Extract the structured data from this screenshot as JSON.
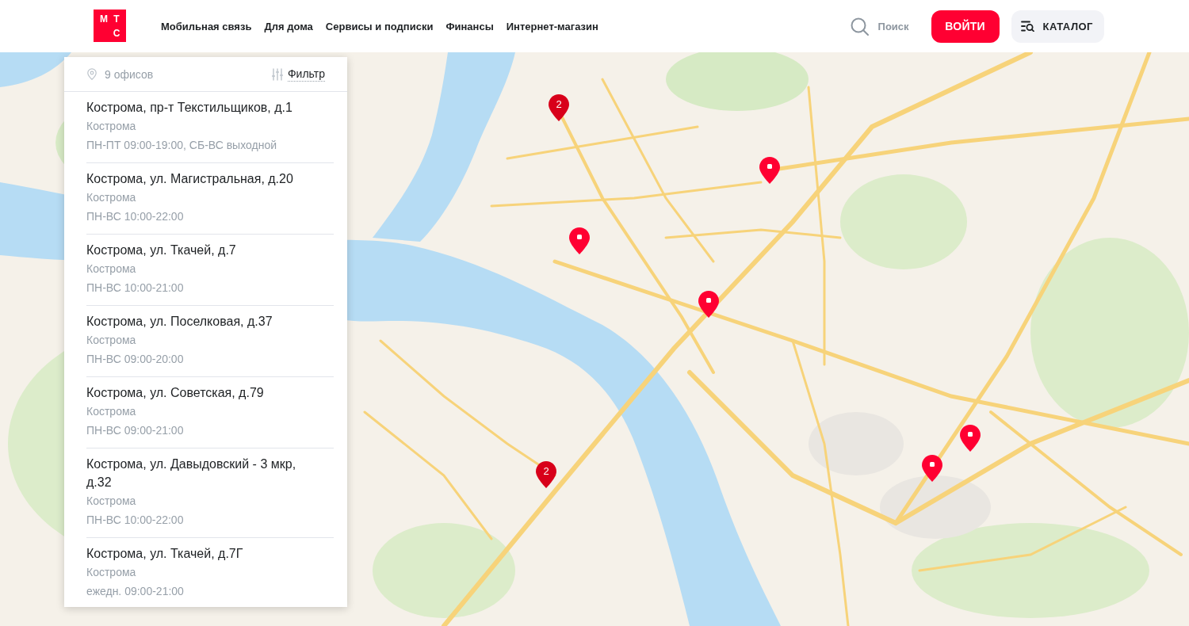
{
  "header": {
    "logo": {
      "letters": [
        "М",
        "Т",
        "С"
      ]
    },
    "nav": [
      "Мобильная связь",
      "Для дома",
      "Сервисы и подписки",
      "Финансы",
      "Интернет-магазин"
    ],
    "search": {
      "label": "Поиск"
    },
    "login_button": "ВОЙТИ",
    "catalog_button": "КАТАЛОГ"
  },
  "offices_panel": {
    "count": "9 офисов",
    "filter": "Фильтр",
    "offices": [
      {
        "address": "Кострома, пр-т Текстильщиков, д.1",
        "city": "Кострома",
        "hours": "ПН-ПТ 09:00-19:00, СБ-ВС выходной"
      },
      {
        "address": "Кострома, ул. Магистральная, д.20",
        "city": "Кострома",
        "hours": "ПН-ВС 10:00-22:00"
      },
      {
        "address": "Кострома, ул. Ткачей, д.7",
        "city": "Кострома",
        "hours": "ПН-ВС 10:00-21:00"
      },
      {
        "address": "Кострома, ул. Поселковая, д.37",
        "city": "Кострома",
        "hours": "ПН-ВС 09:00-20:00"
      },
      {
        "address": "Кострома, ул. Советская, д.79",
        "city": "Кострома",
        "hours": "ПН-ВС 09:00-21:00"
      },
      {
        "address": "Кострома, ул. Давыдовский - 3 мкр, д.32",
        "city": "Кострома",
        "hours": "ПН-ВС 10:00-22:00"
      },
      {
        "address": "Кострома, ул. Ткачей, д.7Г",
        "city": "Кострома",
        "hours": "ежедн. 09:00-21:00"
      }
    ]
  },
  "map": {
    "markers": [
      {
        "kind": "cluster",
        "count": "2"
      },
      {
        "kind": "office"
      },
      {
        "kind": "office"
      },
      {
        "kind": "office"
      },
      {
        "kind": "cluster",
        "count": "2"
      },
      {
        "kind": "office"
      },
      {
        "kind": "office"
      }
    ]
  }
}
